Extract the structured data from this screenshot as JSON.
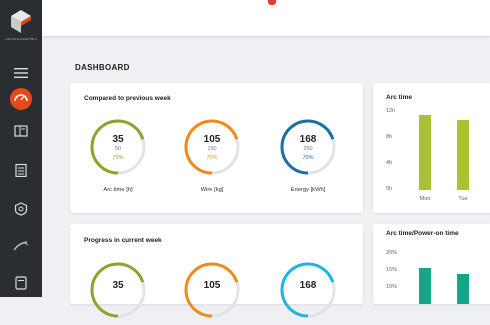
{
  "brand": {
    "name": "LINCOLN ELECTRIC"
  },
  "sidebar": {
    "items": [
      {
        "icon": "menu-icon"
      },
      {
        "icon": "dashboard-gauge-icon",
        "active": true
      },
      {
        "icon": "machines-icon"
      },
      {
        "icon": "clipboard-icon"
      },
      {
        "icon": "shield-icon"
      },
      {
        "icon": "welding-torch-icon"
      },
      {
        "icon": "device-icon"
      }
    ]
  },
  "page_title": "DASHBOARD",
  "compared_card": {
    "title": "Compared to previous week",
    "metrics": [
      {
        "value": "35",
        "previous": "50",
        "percent": "70%",
        "fraction": 0.7,
        "label": "Arc time [h]",
        "color": "#8aa52b"
      },
      {
        "value": "105",
        "previous": "150",
        "percent": "70%",
        "fraction": 0.7,
        "label": "Wire [kg]",
        "color": "#f08a1c"
      },
      {
        "value": "168",
        "previous": "250",
        "percent": "70%",
        "fraction": 0.7,
        "label": "Energy [kWh]",
        "color": "#1b6fa8"
      }
    ]
  },
  "progress_card": {
    "title": "Progress in current week",
    "metrics": [
      {
        "value": "35",
        "color": "#8aa52b",
        "fraction": 0.7
      },
      {
        "value": "105",
        "color": "#f08a1c",
        "fraction": 0.7
      },
      {
        "value": "168",
        "color": "#1ab7e6",
        "fraction": 0.7
      }
    ]
  },
  "arc_time_chart": {
    "title": "Arc time",
    "ticks": [
      "12h",
      "8h",
      "4h",
      "0h"
    ],
    "days": [
      "Mon",
      "Tue"
    ],
    "values": [
      11.5,
      10.8
    ],
    "ymax": 12,
    "color": "#a8c234"
  },
  "arc_power_chart": {
    "title": "Arc time/Power-on time",
    "ticks": [
      "20%",
      "15%",
      "10%"
    ],
    "values": [
      16,
      14
    ],
    "color": "#17a589"
  },
  "colors": {
    "accent": "#e64a19",
    "sidebar": "#2a2d31"
  }
}
